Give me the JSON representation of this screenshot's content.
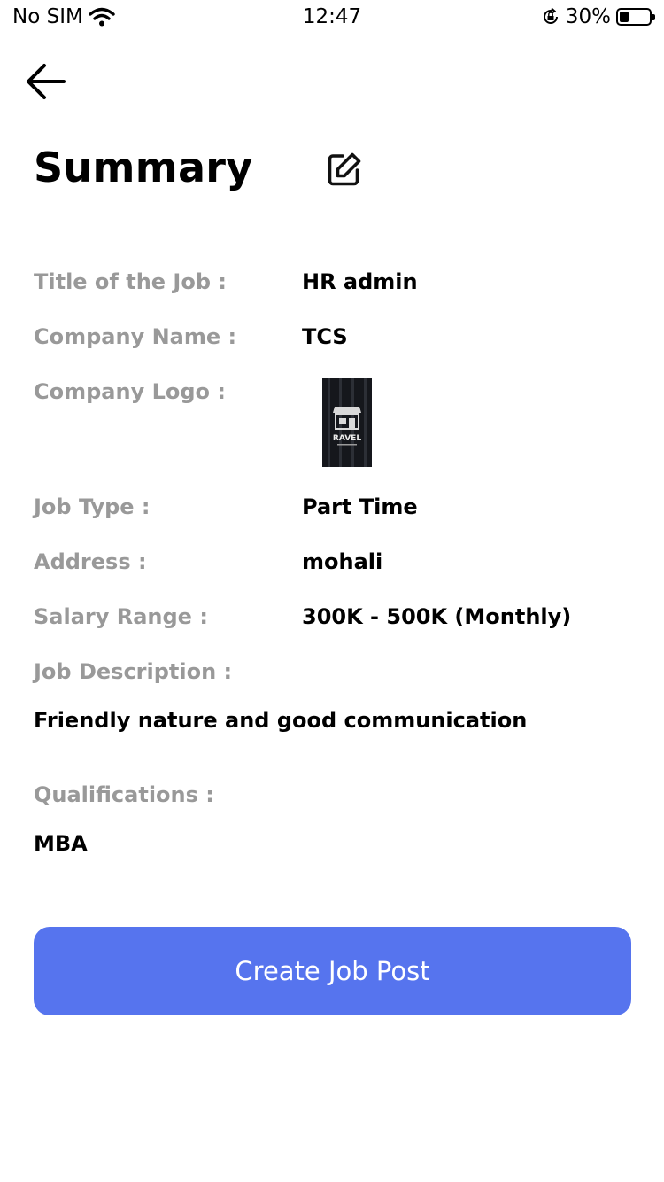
{
  "status_bar": {
    "carrier": "No SIM",
    "time": "12:47",
    "battery_percent": "30%",
    "battery_level": 0.3
  },
  "header": {
    "title": "Summary",
    "back_icon": "arrow-left-icon",
    "edit_icon": "edit-square-icon"
  },
  "details": {
    "job_title": {
      "label": "Title of the Job :",
      "value": "HR admin"
    },
    "company_name": {
      "label": "Company Name :",
      "value": "TCS"
    },
    "company_logo": {
      "label": "Company Logo :",
      "logo_text": "RAVEL"
    },
    "job_type": {
      "label": "Job Type :",
      "value": "Part Time"
    },
    "address": {
      "label": "Address :",
      "value": "mohali"
    },
    "salary_range": {
      "label": "Salary Range :",
      "value": "300K - 500K (Monthly)"
    },
    "job_description": {
      "label": "Job Description :",
      "value": "Friendly nature and good communication"
    },
    "qualifications": {
      "label": "Qualifications :",
      "value": "MBA"
    }
  },
  "actions": {
    "create_label": "Create Job Post",
    "accent_color": "#5674ee"
  }
}
